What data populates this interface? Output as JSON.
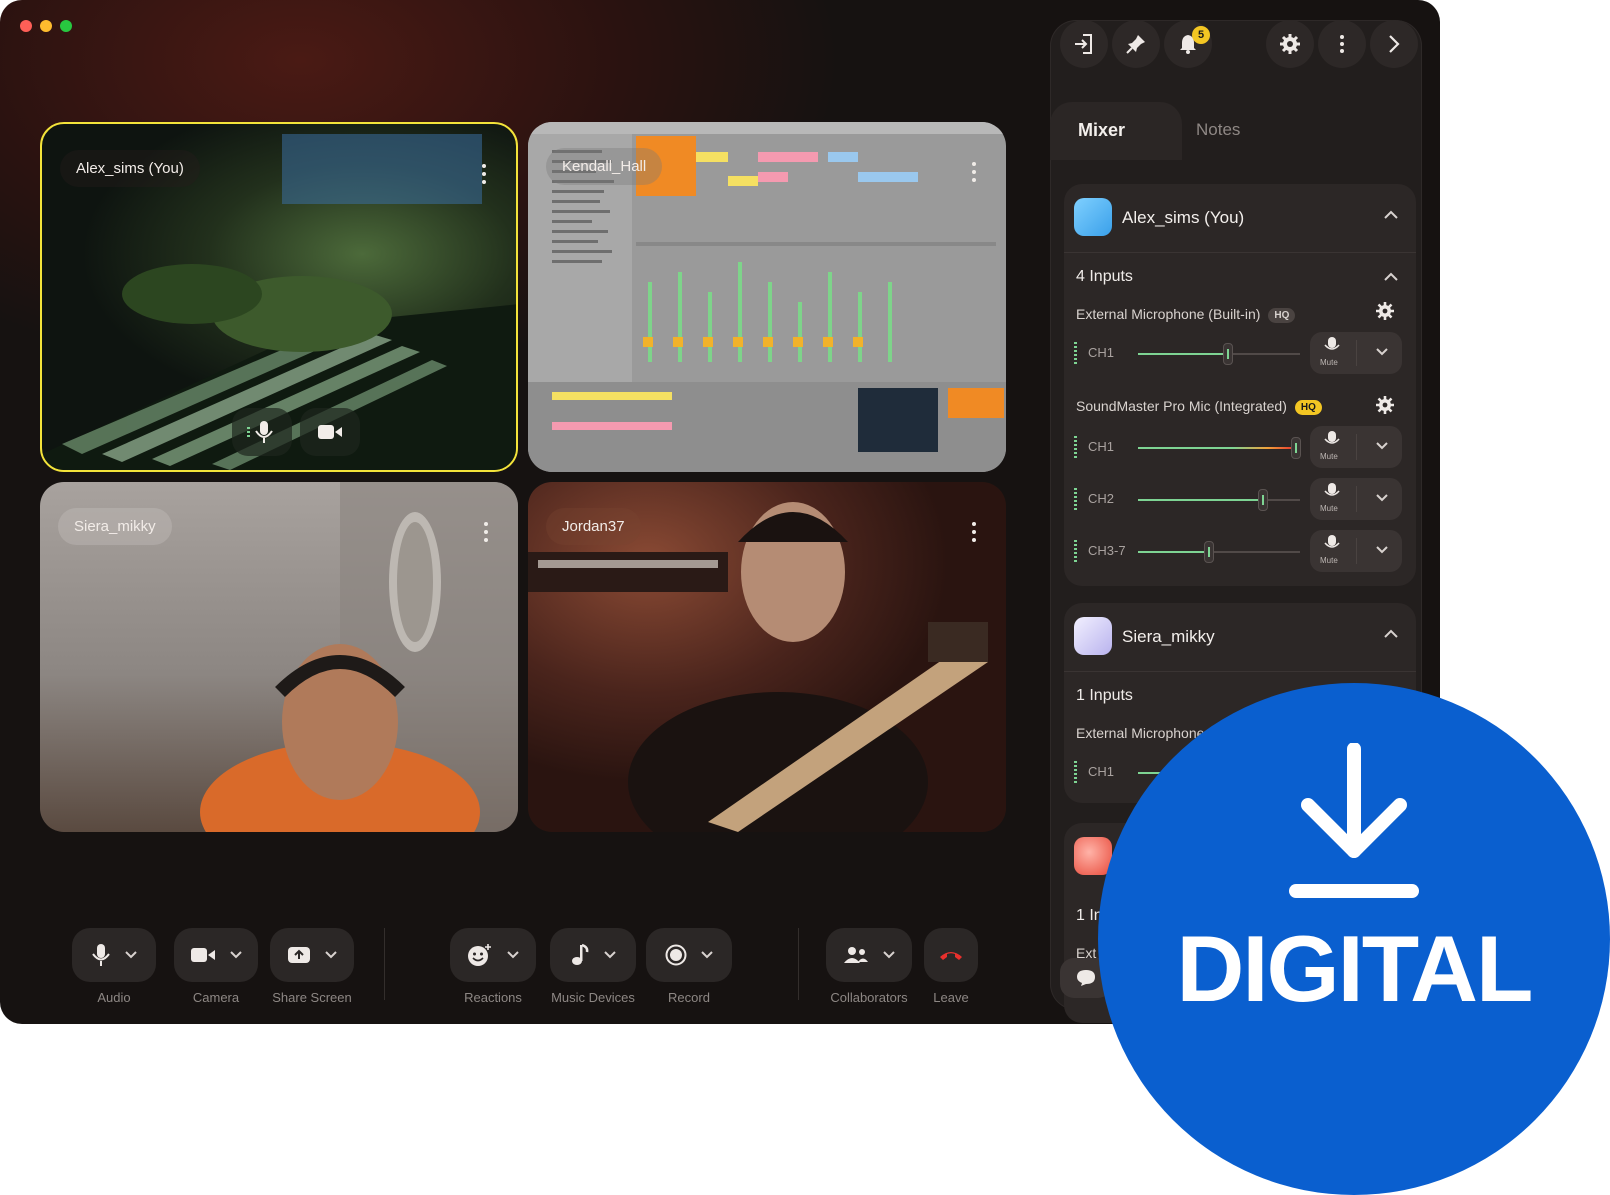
{
  "window": {
    "controls": [
      "close",
      "minimize",
      "maximize"
    ]
  },
  "participants": [
    {
      "name": "Alex_sims (You)",
      "active": true
    },
    {
      "name": "Kendall_Hall"
    },
    {
      "name": "Siera_mikky"
    },
    {
      "name": "Jordan37"
    }
  ],
  "toolbar": {
    "audio": "Audio",
    "camera": "Camera",
    "share_screen": "Share Screen",
    "reactions": "Reactions",
    "music_devices": "Music Devices",
    "record": "Record",
    "collaborators": "Collaborators",
    "leave": "Leave"
  },
  "panel": {
    "notification_count": "5",
    "tabs": {
      "mixer": "Mixer",
      "notes": "Notes"
    },
    "users": [
      {
        "name": "Alex_sims (You)",
        "inputs_title": "4 Inputs",
        "devices": [
          {
            "label": "External Microphone (Built-in)",
            "badge": "HQ",
            "channels": [
              {
                "label": "CH1",
                "level": 0.55,
                "mute": "Mute"
              }
            ]
          },
          {
            "label": "SoundMaster Pro Mic (Integrated)",
            "badge": "HQ",
            "channels": [
              {
                "label": "CH1",
                "level": 0.97,
                "mute": "Mute"
              },
              {
                "label": "CH2",
                "level": 0.77,
                "mute": "Mute"
              },
              {
                "label": "CH3-7",
                "level": 0.44,
                "mute": "Mute"
              }
            ]
          }
        ]
      },
      {
        "name": "Siera_mikky",
        "inputs_title": "1 Inputs",
        "devices": [
          {
            "label": "External Microphone",
            "channels": [
              {
                "label": "CH1"
              }
            ]
          }
        ]
      },
      {
        "name": "",
        "inputs_title": "1 In",
        "device_label": "Ext"
      }
    ]
  },
  "promo": {
    "text": "DIGITAL"
  },
  "colors": {
    "accent_yellow": "#f3e33a",
    "leave_red": "#e8302d",
    "level_green": "#7ed493",
    "promo_blue": "#0a5fcf"
  }
}
